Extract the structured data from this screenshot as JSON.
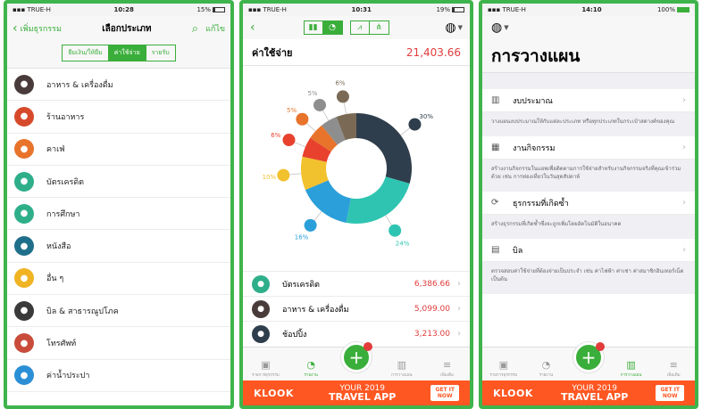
{
  "phone1": {
    "status": {
      "carrier": "TRUE-H",
      "time": "10:28",
      "battery": "15%"
    },
    "header": {
      "back_label": "เพิ่มธุรกรรม",
      "title": "เลือกประเภท",
      "edit_label": "แก้ไข"
    },
    "segments": [
      "ยืมเงิน/ให้ยืม",
      "ค่าใช้จ่าย",
      "รายรับ"
    ],
    "active_segment": 1,
    "categories": [
      {
        "label": "อาหาร & เครื่องดื่ม",
        "icon": "food-drink-icon",
        "color": "#4a3b3b"
      },
      {
        "label": "ร้านอาหาร",
        "icon": "restaurant-icon",
        "color": "#d64a2b"
      },
      {
        "label": "คาเฟ่",
        "icon": "cafe-icon",
        "color": "#e8732b"
      },
      {
        "label": "บัตรเครดิต",
        "icon": "credit-card-icon",
        "color": "#2fae8a"
      },
      {
        "label": "การศึกษา",
        "icon": "education-icon",
        "color": "#2fae8a"
      },
      {
        "label": "หนังสือ",
        "icon": "book-icon",
        "color": "#1f6f8b"
      },
      {
        "label": "อื่น ๆ",
        "icon": "box-icon",
        "color": "#f0b323"
      },
      {
        "label": "บิล & สาธารณูปโภค",
        "icon": "bill-icon",
        "color": "#3a3a3a"
      },
      {
        "label": "โทรศัพท์",
        "icon": "phone-icon",
        "color": "#c94c3a"
      },
      {
        "label": "ค่าน้ำประปา",
        "icon": "water-icon",
        "color": "#2b8fd6"
      }
    ]
  },
  "phone2": {
    "status": {
      "carrier": "TRUE-H",
      "time": "10:31",
      "battery": "19%"
    },
    "total_label": "ค่าใช้จ่าย",
    "total_value": "21,403.66",
    "chart_data": {
      "type": "pie",
      "labels": [
        "30%",
        "24%",
        "16%",
        "10%",
        "6%",
        "5%",
        "5%",
        "6%"
      ],
      "values": [
        30,
        24,
        16,
        10,
        6,
        5,
        5,
        6
      ],
      "colors": [
        "#2f3e4c",
        "#2fc4b2",
        "#2b9fd9",
        "#f2c12e",
        "#e8412e",
        "#e8732b",
        "#8e8e8e",
        "#7a6a55"
      ]
    },
    "rows": [
      {
        "label": "บัตรเครดิต",
        "amount": "6,386.66",
        "color": "#2fae8a"
      },
      {
        "label": "อาหาร & เครื่องดื่ม",
        "amount": "5,099.00",
        "color": "#4a3b3b"
      },
      {
        "label": "ช้อปปิ้ง",
        "amount": "3,213.00",
        "color": "#2f3e4c"
      }
    ]
  },
  "phone3": {
    "status": {
      "carrier": "TRUE-H",
      "time": "14:10",
      "battery": "100%"
    },
    "title": "การวางแผน",
    "items": [
      {
        "label": "งบประมาณ",
        "icon": "budget-icon",
        "desc": "วางแผนงบประมาณให้กับแต่ละประเภท หรือทุกประเภทในกระเป๋าสตางค์ของคุณ"
      },
      {
        "label": "งานกิจกรรม",
        "icon": "calendar-icon",
        "desc": "สร้างงานกิจกรรมในแอพเพื่อติดตามการใช้จ่ายสำหรับงานกิจกรรมจริงที่คุณเข้าร่วมด้วย เช่น การท่องเที่ยวในวันสุดสัปดาห์"
      },
      {
        "label": "ธุรกรรมที่เกิดซ้ำ",
        "icon": "recurring-icon",
        "desc": "สร้างธุรกรรมที่เกิดซ้ำซึ่งจะถูกเพิ่มโดยอัตโนมัติในอนาคต"
      },
      {
        "label": "บิล",
        "icon": "bill-icon",
        "desc": "ตรวจสอบค่าใช้จ่ายที่ต้องจ่ายเป็นประจำ เช่น ค่าไฟฟ้า ค่าเช่า ค่าสมาชิกอินเทอร์เน็ต เป็นต้น"
      }
    ]
  },
  "tabbar": {
    "tabs": [
      "รายการธุรกรรม",
      "รายงาน",
      "",
      "การวางแผน",
      "เพิ่มเติม"
    ]
  },
  "ad": {
    "brand": "KLOOK",
    "line1": "YOUR 2019",
    "line2": "TRAVEL APP",
    "cta1": "GET IT",
    "cta2": "NOW"
  }
}
